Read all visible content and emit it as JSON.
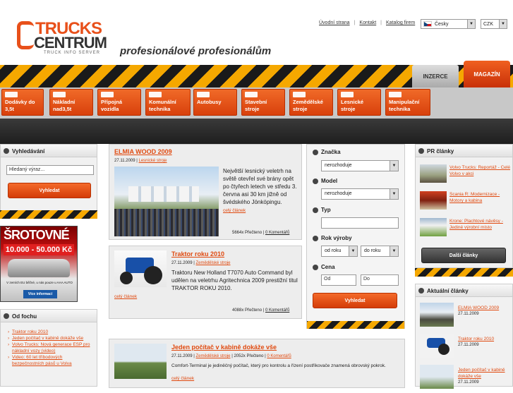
{
  "brand": {
    "name_top": "TRUCKS",
    "name_bottom": "CENTRUM",
    "sub": "TRUCK INFO SERVER",
    "slogan": "profesionálové profesionálům"
  },
  "top_links": [
    "Úvodní strana",
    "Kontakt",
    "Katalog firem"
  ],
  "language": "Česky",
  "currency": "CZK",
  "tabs": {
    "inzerce": "INZERCE",
    "magazin": "MAGAZÍN"
  },
  "nav": [
    {
      "line1": "Dodávky do",
      "line2": "3,5t"
    },
    {
      "line1": "Nákladní",
      "line2": "nad3,5t"
    },
    {
      "line1": "Přípojná",
      "line2": "vozidla"
    },
    {
      "line1": "Komunální",
      "line2": "technika"
    },
    {
      "line1": "Autobusy",
      "line2": ""
    },
    {
      "line1": "Stavební",
      "line2": "stroje"
    },
    {
      "line1": "Zemědělské",
      "line2": "stroje"
    },
    {
      "line1": "Lesnické",
      "line2": "stroje"
    },
    {
      "line1": "Manipulační",
      "line2": "technika"
    }
  ],
  "search_box": {
    "title": "Vyhledávání",
    "placeholder": "Hledaný výraz...",
    "button": "Vyhledat"
  },
  "ad": {
    "line1": "ŠROTOVNÉ",
    "line2": "10.000 - 50.000 Kč",
    "line3": "V zemích EU běžné, u nás pouze u AAA AUTO",
    "button": "Více informací"
  },
  "od_fochu": {
    "title": "Od fochu",
    "items": [
      "Traktor roku 2010",
      "Jeden počítač v kabině dokáže vše",
      "Volvo Trucks: Nová generace ESP pro nákladní vozy (video)",
      "Video: 60 let tříbodových bezpečnostních pásů u Volva"
    ]
  },
  "articles": [
    {
      "title": "ELMIA WOOD 2009",
      "date": "27.11.2009",
      "category": "Lesnické stroje",
      "text": "Největší lesnický veletrh na světě otevřel své brány opět po čtyřech letech ve středu 3. června asi 30 km jižně od švédského Jönköpingu.",
      "more": "celý článek",
      "reads": "5664x Přečteno",
      "comments": "0 Komentářů"
    },
    {
      "title": "Traktor roku 2010",
      "date": "27.11.2009",
      "category": "Zemědělské stroje",
      "text": "Traktoru New Holland T7070 Auto Command byl udělen na veletrhu Agritechnica 2009 prestižní titul TRAKTOR ROKU 2010.",
      "more": "celý článek",
      "reads": "4088x Přečteno",
      "comments": "0 Komentářů"
    },
    {
      "title": "Jeden počítač v kabině dokáže vše",
      "date": "27.11.2009",
      "category": "Zemědělské stroje",
      "reads_inline": "2052x Přečteno",
      "comments": "0 Komentářů",
      "text": "Comfort-Terminal je jediněčný počítač, který pro kontrolu a řízení postřikovače znamená obrovský pokrok.",
      "more": "celý článek"
    }
  ],
  "filter": {
    "znacka_label": "Značka",
    "znacka_value": "nerozhoduje",
    "model_label": "Model",
    "model_value": "nerozhoduje",
    "typ_label": "Typ",
    "rok_label": "Rok výroby",
    "rok_from": "od roku",
    "rok_to": "do roku",
    "cena_label": "Cena",
    "cena_from_placeholder": "Od",
    "cena_to_placeholder": "Do",
    "button": "Vyhledat"
  },
  "pr": {
    "title": "PR články",
    "items": [
      {
        "title": "Volvo Trucks: Reportáž - Celé Volvo v akci"
      },
      {
        "title": "Scania R: Modernizace - Motory a kabina"
      },
      {
        "title": "Krone: Plachtové návěsy - Jediné výrobní místo"
      }
    ],
    "more_button": "Další články"
  },
  "recent": {
    "title": "Aktuální články",
    "items": [
      {
        "title": "ELMIA WOOD 2009",
        "date": "27.11.2009"
      },
      {
        "title": "Traktor roku 2010",
        "date": "27.11.2009"
      },
      {
        "title": "Jeden počítač v kabině dokáže vše",
        "date": "27.11.2009"
      }
    ]
  },
  "colors": {
    "accent": "#e8501a",
    "hazard_yellow": "#f5a800",
    "dark": "#1a1a1a"
  }
}
